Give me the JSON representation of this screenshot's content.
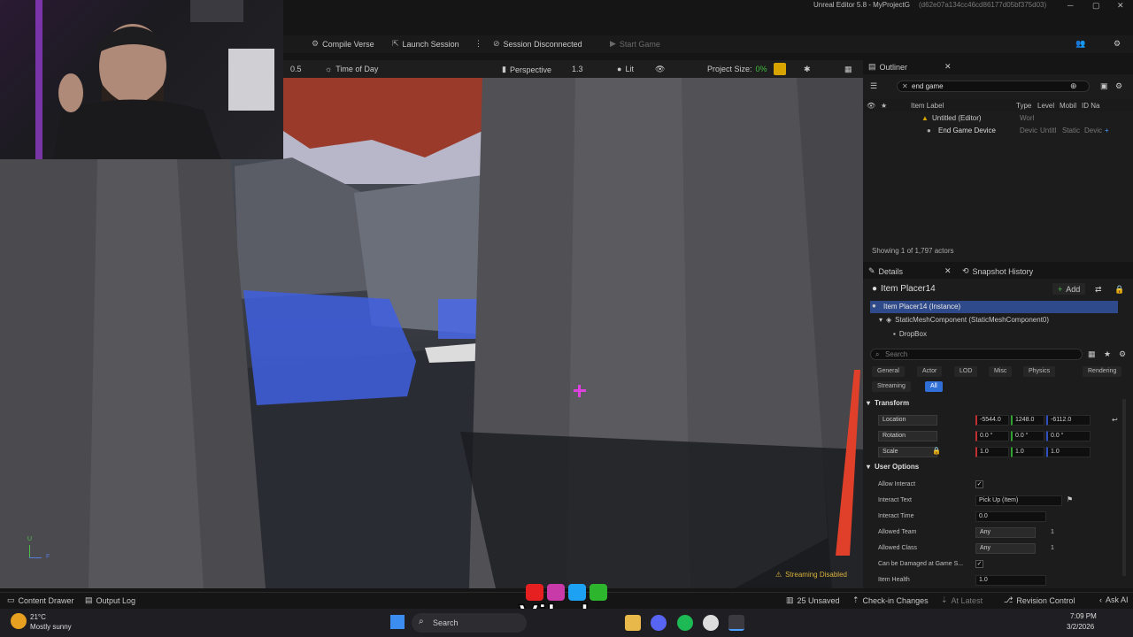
{
  "window": {
    "title": "Unreal Editor 5.8 - MyProjectG",
    "id_suffix": "(d62e07a134cc46cd86177d05bf375d03)",
    "minimize": "─",
    "maximize": "▢",
    "close": "✕"
  },
  "toolbar": {
    "compile_verse": "Compile Verse",
    "launch_session": "Launch Session",
    "session_status": "Session Disconnected",
    "start_game": "Start Game"
  },
  "viewport_toolbar": {
    "speed": "0.5",
    "time_of_day": "Time of Day",
    "perspective": "Perspective",
    "fov": "1.3",
    "lit": "Lit",
    "project_size_label": "Project Size:",
    "project_size_value": "0%"
  },
  "viewport": {
    "streaming": "Streaming Disabled",
    "axis_u": "U",
    "axis_f": "F"
  },
  "outliner": {
    "tab": "Outliner",
    "search_value": "end game",
    "columns": [
      "Item Label",
      "Type",
      "Level",
      "Mobil",
      "ID Na"
    ],
    "rows": [
      {
        "label": "Untitled (Editor)",
        "type": "Worl"
      },
      {
        "label": "End Game Device",
        "type": "Devic",
        "level": "Untitl",
        "mobility": "Static",
        "idname": "Devic"
      }
    ],
    "count": "Showing 1 of 1,797 actors"
  },
  "details": {
    "tab": "Details",
    "tab2": "Snapshot History",
    "actor_name": "Item Placer14",
    "add": "Add",
    "tree": [
      "Item Placer14 (Instance)",
      "StaticMeshComponent (StaticMeshComponent0)",
      "DropBox"
    ],
    "search_placeholder": "Search",
    "filters_row1": [
      "General",
      "Actor",
      "LOD",
      "Misc",
      "Physics",
      "Rendering"
    ],
    "filters_row2": [
      "Streaming",
      "All"
    ],
    "transform_header": "Transform",
    "location_label": "Location",
    "location": [
      "-5544.0",
      "1248.0",
      "-6112.0"
    ],
    "rotation_label": "Rotation",
    "rotation": [
      "0.0 °",
      "0.0 °",
      "0.0 °"
    ],
    "scale_label": "Scale",
    "scale": [
      "1.0",
      "1.0",
      "1.0"
    ],
    "user_options_header": "User Options",
    "allow_interact": "Allow Interact",
    "interact_text_label": "Interact Text",
    "interact_text": "Pick Up (Item)",
    "interact_time_label": "Interact Time",
    "interact_time": "0.0",
    "allowed_team_label": "Allowed Team",
    "allowed_team": "Any",
    "allowed_team_num": "1",
    "allowed_class_label": "Allowed Class",
    "allowed_class": "Any",
    "allowed_class_num": "1",
    "damaged_label": "Can be Damaged at Game S...",
    "item_health_label": "Item Health",
    "item_health": "1.0"
  },
  "statusbar": {
    "content_drawer": "Content Drawer",
    "output_log": "Output Log",
    "unsaved": "25 Unsaved",
    "check_in": "Check-in Changes",
    "at_latest": "At Latest",
    "revision_control": "Revision Control",
    "ask_ai": "Ask AI"
  },
  "overlay": {
    "brand": "Vibzlo"
  },
  "taskbar": {
    "temp": "21°C",
    "weather": "Mostly sunny",
    "search": "Search",
    "time": "7:09 PM",
    "date": "3/2/2026"
  }
}
